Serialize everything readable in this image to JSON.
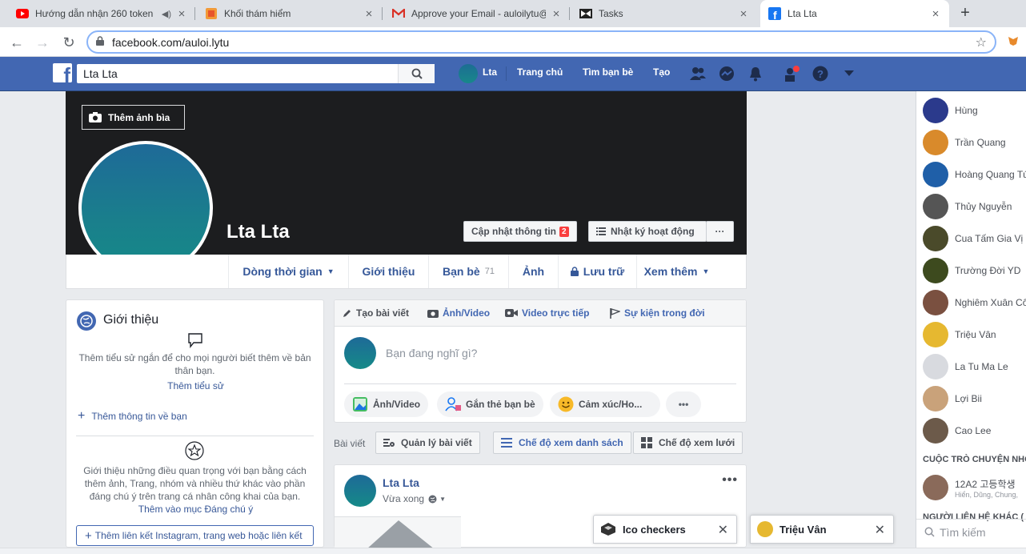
{
  "browser": {
    "tabs": [
      {
        "title": "Hướng dẫn nhận 260 token",
        "icon": "youtube-icon"
      },
      {
        "title": "Khối thám hiểm",
        "icon": "bookmark-app-icon"
      },
      {
        "title": "Approve your Email - auloilytu@",
        "icon": "gmail-icon"
      },
      {
        "title": "Tasks",
        "icon": "tasks-icon"
      },
      {
        "title": "Lta Lta",
        "icon": "facebook-icon"
      }
    ],
    "url": "facebook.com/auloi.lytu"
  },
  "fb_header": {
    "search_value": "Lta Lta",
    "user_short": "Lta",
    "nav": [
      "Trang chủ",
      "Tìm bạn bè",
      "Tạo"
    ]
  },
  "profile": {
    "name": "Lta Lta",
    "add_cover": "Thêm ảnh bìa",
    "update_info": "Cập nhật thông tin",
    "update_badge": "2",
    "activity_log": "Nhật ký hoạt động",
    "more_dots": "···",
    "tabs": [
      {
        "label": "Dòng thời gian"
      },
      {
        "label": "Giới thiệu"
      },
      {
        "label": "Bạn bè",
        "count": "71"
      },
      {
        "label": "Ảnh"
      },
      {
        "label": "Lưu trữ"
      },
      {
        "label": "Xem thêm"
      }
    ]
  },
  "intro": {
    "title": "Giới thiệu",
    "bio_text": "Thêm tiểu sử ngắn để cho mọi người biết thêm về bản thân bạn.",
    "bio_link": "Thêm tiểu sử",
    "add_info": "Thêm thông tin về bạn",
    "featured_text": "Giới thiệu những điều quan trọng với bạn bằng cách thêm ảnh, Trang, nhóm và nhiều thứ khác vào phần đáng chú ý trên trang cá nhân công khai của bạn.",
    "featured_link": "Thêm vào mục Đáng chú ý",
    "links_button": "Thêm liên kết Instagram, trang web hoặc liên kết"
  },
  "composer": {
    "tabs": [
      "Tạo bài viết",
      "Ảnh/Video",
      "Video trực tiếp",
      "Sự kiện trong đời"
    ],
    "placeholder": "Bạn đang nghĩ gì?",
    "actions": [
      "Ảnh/Video",
      "Gắn thẻ bạn bè",
      "Cảm xúc/Ho..."
    ],
    "more": "•••"
  },
  "posts_bar": {
    "label": "Bài viết",
    "manage": "Quản lý bài viết",
    "list_view": "Chế độ xem danh sách",
    "grid_view": "Chế độ xem lưới"
  },
  "post": {
    "author": "Lta Lta",
    "time": "Vừa xong",
    "more": "•••"
  },
  "sidebar": {
    "contacts": [
      {
        "name": "Hùng",
        "color": "#2b3a8c"
      },
      {
        "name": "Trần Quang",
        "color": "#d98a2b"
      },
      {
        "name": "Hoàng Quang Tú",
        "color": "#1f5fa8"
      },
      {
        "name": "Thủy Nguyễn",
        "color": "#555555"
      },
      {
        "name": "Cua Tấm Gia Vị",
        "color": "#4a4a2a"
      },
      {
        "name": "Trường Đời YD",
        "color": "#3d4a1e"
      },
      {
        "name": "Nghiêm Xuân Cô",
        "color": "#7a5040"
      },
      {
        "name": "Triệu Vân",
        "color": "#e6b830"
      },
      {
        "name": "La Tu Ma Le",
        "color": "#d8dadf"
      },
      {
        "name": "Lợi Bii",
        "color": "#c9a27a"
      },
      {
        "name": "Cao Lee",
        "color": "#6c5a4a"
      }
    ],
    "group_header": "CUỘC TRÒ CHUYỆN NHÓ",
    "group": {
      "name": "12A2 고등학생",
      "members": "Hiển, Dũng, Chung,"
    },
    "other_header": "NGƯỜI LIÊN HỆ KHÁC (",
    "search_placeholder": "Tìm kiếm"
  },
  "chats": [
    {
      "name": "Ico checkers"
    },
    {
      "name": "Triệu Vân"
    }
  ],
  "colors": {
    "fb_blue": "#4267b2",
    "link": "#385898",
    "cover": "#1c1d1f"
  }
}
